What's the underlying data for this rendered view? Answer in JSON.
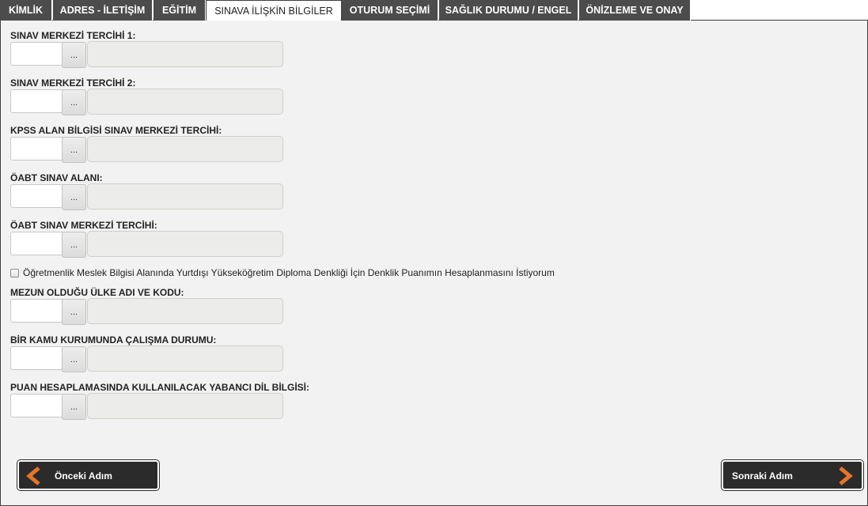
{
  "tabs": [
    {
      "label": "KİMLİK"
    },
    {
      "label": "ADRES - İLETİŞİM"
    },
    {
      "label": "EĞİTİM"
    },
    {
      "label": "SINAVA İLİŞKİN BİLGİLER"
    },
    {
      "label": "OTURUM SEÇİMİ"
    },
    {
      "label": "SAĞLIK DURUMU / ENGEL"
    },
    {
      "label": "ÖNİZLEME VE ONAY"
    }
  ],
  "active_tab": "SINAVA İLİŞKİN BİLGİLER",
  "fields": [
    {
      "label": "SINAV MERKEZİ TERCİHİ 1:",
      "code": "",
      "name": "",
      "button": "..."
    },
    {
      "label": "SINAV MERKEZİ TERCİHİ 2:",
      "code": "",
      "name": "",
      "button": "..."
    },
    {
      "label": "KPSS ALAN BİLGİSİ SINAV MERKEZİ TERCİHİ:",
      "code": "",
      "name": "",
      "button": "..."
    },
    {
      "label": "ÖABT SINAV ALANI:",
      "code": "",
      "name": "",
      "button": "..."
    },
    {
      "label": "ÖABT SINAV MERKEZİ TERCİHİ:",
      "code": "",
      "name": "",
      "button": "..."
    },
    {
      "label": "MEZUN OLDUĞU ÜLKE ADI VE KODU:",
      "code": "",
      "name": "",
      "button": "..."
    },
    {
      "label": "BİR KAMU KURUMUNDA ÇALIŞMA DURUMU:",
      "code": "",
      "name": "",
      "button": "..."
    },
    {
      "label": "PUAN HESAPLAMASINDA KULLANILACAK YABANCI DİL BİLGİSİ:",
      "code": "",
      "name": "",
      "button": "..."
    }
  ],
  "checkbox": {
    "label": "Öğretmenlik Meslek Bilgisi Alanında Yurtdışı Yükseköğretim Diploma Denkliği İçin Denklik Puanımın Hesaplanmasını İstiyorum",
    "checked": false
  },
  "nav": {
    "prev_label": "Önceki Adım",
    "next_label": "Sonraki Adım",
    "arrow_color": "#e8742a"
  }
}
